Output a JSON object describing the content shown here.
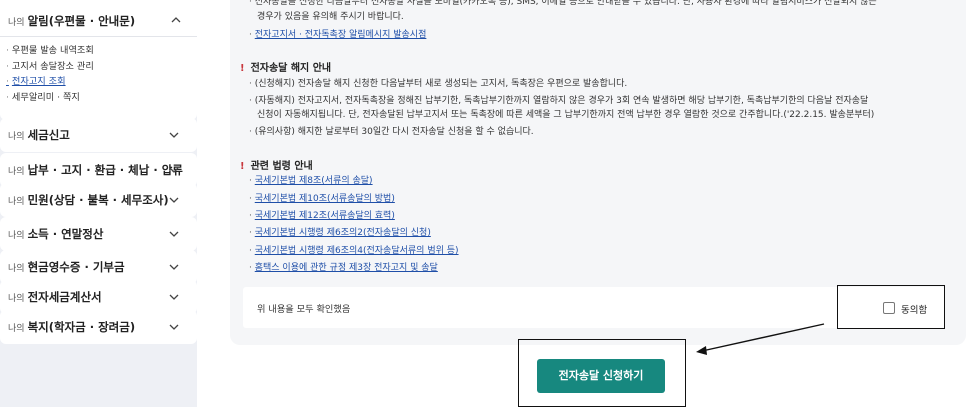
{
  "sidebar": {
    "prefix": "나의",
    "open_group": {
      "title": "알림(우편물 · 안내문)",
      "items": [
        {
          "label": "우편물 발송 내역조회",
          "active": false
        },
        {
          "label": "고지서 송달장소 관리",
          "active": false
        },
        {
          "label": "전자고지 조회",
          "active": true
        },
        {
          "label": "세무알리미 · 쪽지",
          "active": false
        }
      ]
    },
    "groups": [
      {
        "title": "세금신고"
      },
      {
        "title": "납부 · 고지 · 환급 · 체납 · 압류"
      },
      {
        "title": "민원(상담 · 불복 · 세무조사)"
      },
      {
        "title": "소득 · 연말정산"
      },
      {
        "title": "현금영수증 · 기부금"
      },
      {
        "title": "전자세금계산서"
      },
      {
        "title": "복지(학자금 · 장려금)"
      }
    ]
  },
  "content": {
    "intro_line1": "전자송달을 신청한 다음날부터 전자송달 사실을 모바일(카카오톡 등), SMS, 이메일 등으로 안내받을 수 있습니다. 단, 사용자 환경에 따라 알림서비스가 전달되지 않는",
    "intro_line2": "경우가 있음을 유의해 주시기 바랍니다.",
    "intro_link": "전자고지서 · 전자독촉장 알림메시지 발송시점",
    "cancel_section": {
      "title": "전자송달 해지 안내",
      "items": [
        "(신청해지) 전자송달 해지 신청한 다음날부터 새로 생성되는 고지서, 독촉장은 우편으로 발송합니다.",
        "(자동해지) 전자고지서, 전자독촉장을 정해진 납부기한, 독촉납부기한까지 열람하지 않은 경우가 3회 연속 발생하면 해당 납부기한, 독촉납부기한의 다음날 전자송달",
        "신청이 자동해지됩니다. 단, 전자송달된 납부고지서 또는 독촉장에 따른 세액을 그 납부기한까지 전액 납부한 경우 열람한 것으로 간주합니다.('22.2.15. 발송분부터)",
        "(유의사항) 해지한 날로부터 30일간 다시 전자송달 신청을 할 수 없습니다."
      ]
    },
    "law_section": {
      "title": "관련 법령 안내",
      "links": [
        "국세기본법 제8조(서류의 송달)",
        "국세기본법 제10조(서류송달의 방법)",
        "국세기본법 제12조(서류송달의 효력)",
        "국세기본법 시행령 제6조의2(전자송달의 신청)",
        "국세기본법 시행령 제6조의4(전자송달서류의 범위 등)",
        "홈택스 이용에 관한 규정 제3장 전자고지 및 송달"
      ]
    },
    "confirm_text": "위 내용을 모두 확인했음",
    "agree_label": "동의함",
    "submit_label": "전자송달 신청하기"
  },
  "colors": {
    "accent_button": "#17887f",
    "link": "#1f4fa8",
    "section_mark": "#c8383e",
    "sidebar_bg": "#eef0f5"
  }
}
